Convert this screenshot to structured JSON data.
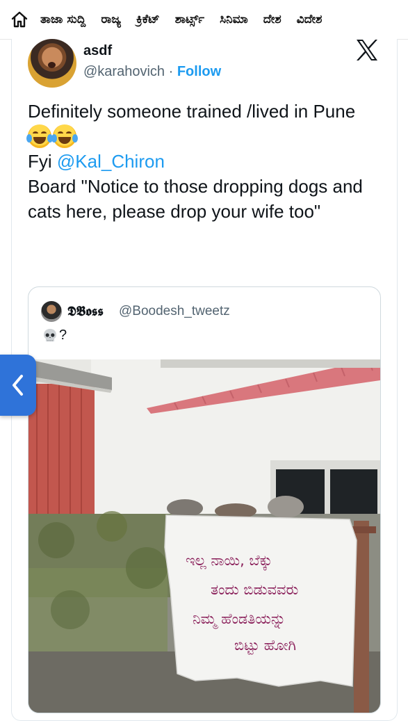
{
  "nav": {
    "items": [
      "ತಾಜಾ ಸುದ್ದಿ",
      "ರಾಜ್ಯ",
      "ಕ್ರಿಕೆಟ್",
      "ಶಾರ್ಟ್ಸ್",
      "ಸಿನಿಮಾ",
      "ದೇಶ",
      "ವಿದೇಶ"
    ]
  },
  "tweet": {
    "display_name": "asdf",
    "handle": "@karahovich",
    "separator": "·",
    "follow_label": "Follow",
    "line1": "Definitely someone trained /lived in Pune",
    "emojis": [
      "face-with-tears-of-joy",
      "face-with-tears-of-joy"
    ],
    "fyi_prefix": "Fyi ",
    "mention": "@Kal_Chiron",
    "line3": "Board \"Notice to those dropping dogs and cats here, please drop your wife too\""
  },
  "quoted_tweet": {
    "display_name": "𝕯𝕭𝖔𝖘𝖘",
    "handle": "@Boodesh_tweetz",
    "text_suffix": "?",
    "emoji": "skull",
    "photo": {
      "banner_lines": [
        "ಇಲ್ಲ ನಾಯಿ, ಬೆಕ್ಕು",
        "ತಂದು ಬಿಡುವವರು",
        "ನಿಮ್ಮ ಹೆಂಡತಿಯನ್ನು",
        "ಬಿಟ್ಟು ಹೋಗಿ"
      ]
    }
  },
  "colors": {
    "link_blue": "#1d9bf0",
    "muted_gray": "#536471",
    "back_tab_blue": "#2f73d9"
  }
}
